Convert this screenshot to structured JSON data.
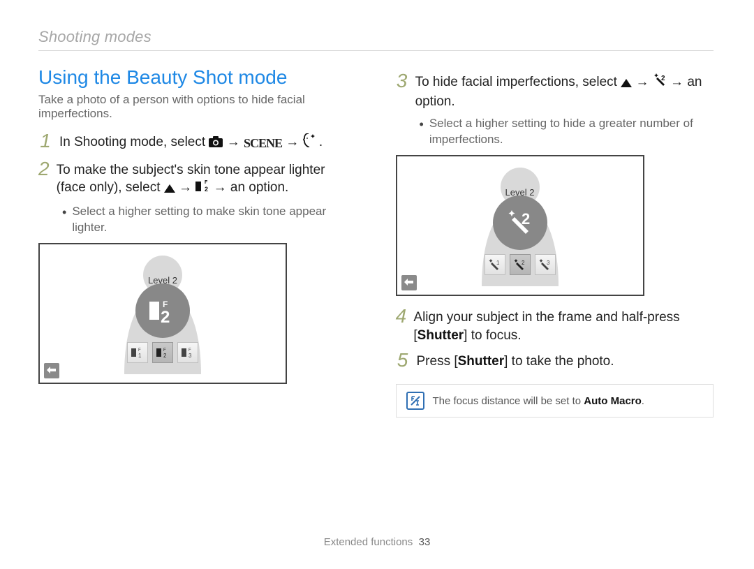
{
  "section_label": "Shooting modes",
  "heading": "Using the Beauty Shot mode",
  "lead": "Take a photo of a person with options to hide facial imperfections.",
  "steps": {
    "s1": {
      "num": "1",
      "pre": "In Shooting mode, select ",
      "scene_word": "SCENE",
      "end": "."
    },
    "s2": {
      "num": "2",
      "pre": "To make the subject's skin tone appear lighter (face only), select ",
      "post": " → an option."
    },
    "s2_bullet": "Select a higher setting to make skin tone appear lighter.",
    "s3": {
      "num": "3",
      "pre": "To hide facial imperfections, select ",
      "post": " → an option."
    },
    "s3_bullet": "Select a higher setting to hide a greater number of imperfections.",
    "s4": {
      "num": "4",
      "pre": "Align your subject in the frame and half-press [",
      "bold": "Shutter",
      "post": "] to focus."
    },
    "s5": {
      "num": "5",
      "pre": "Press [",
      "bold": "Shutter",
      "post": "] to take the photo."
    }
  },
  "note": {
    "pre": "The focus distance will be set to ",
    "bold": "Auto Macro",
    "post": "."
  },
  "shot": {
    "level_label": "Level 2"
  },
  "footer": {
    "label": "Extended functions",
    "page": "33"
  }
}
